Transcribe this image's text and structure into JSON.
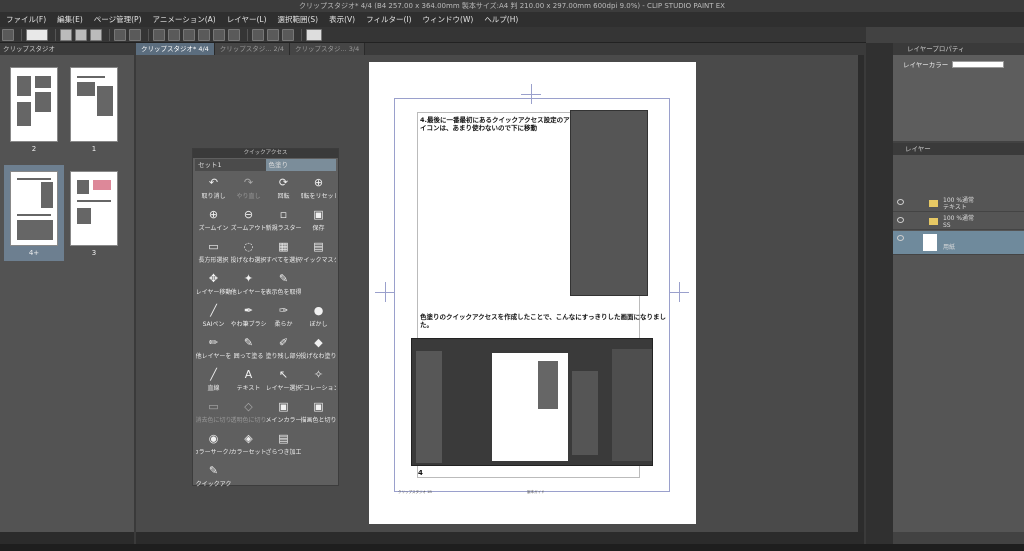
{
  "titlebar": {
    "title": "クリップスタジオ* 4/4 (B4 257.00 x 364.00mm 製本サイズ:A4 判 210.00 x 297.00mm 600dpi 9.0%) - CLIP STUDIO PAINT EX"
  },
  "menu": [
    "ファイル(F)",
    "編集(E)",
    "ページ管理(P)",
    "アニメーション(A)",
    "レイヤー(L)",
    "選択範囲(S)",
    "表示(V)",
    "フィルター(I)",
    "ウィンドウ(W)",
    "ヘルプ(H)"
  ],
  "left_panel": {
    "tab": "クリップスタジオ",
    "pages": [
      {
        "label": "2",
        "selected": false
      },
      {
        "label": "1",
        "selected": false
      },
      {
        "label": "4+",
        "selected": true
      },
      {
        "label": "3",
        "selected": false
      }
    ]
  },
  "canvas_tabs": [
    {
      "label": "クリップスタジオ* 4/4",
      "active": true
    },
    {
      "label": "クリップスタジ... 2/4",
      "active": false
    },
    {
      "label": "クリップスタジ... 3/4",
      "active": false
    }
  ],
  "quick_access": {
    "title": "クイックアクセス",
    "sets": [
      "セット1",
      "色塗り"
    ],
    "active_set": 1,
    "items": [
      {
        "label": "取り消し",
        "icon": "↶",
        "dim": false
      },
      {
        "label": "やり直し",
        "icon": "↷",
        "dim": true
      },
      {
        "label": "回転",
        "icon": "⟳",
        "dim": false
      },
      {
        "label": "回転をリセット",
        "icon": "⊕",
        "dim": false
      },
      {
        "label": "ズームイン",
        "icon": "⊕",
        "dim": false
      },
      {
        "label": "ズームアウト",
        "icon": "⊖",
        "dim": false
      },
      {
        "label": "新規ラスター",
        "icon": "▫",
        "dim": false
      },
      {
        "label": "保存",
        "icon": "▣",
        "dim": false
      },
      {
        "label": "長方形選択",
        "icon": "▭",
        "dim": false
      },
      {
        "label": "投げなわ選択",
        "icon": "◌",
        "dim": false
      },
      {
        "label": "すべてを選択",
        "icon": "▦",
        "dim": false
      },
      {
        "label": "クイックマスク",
        "icon": "▤",
        "dim": false
      },
      {
        "label": "レイヤー移動",
        "icon": "✥",
        "dim": false
      },
      {
        "label": "他レイヤーを",
        "icon": "✦",
        "dim": false
      },
      {
        "label": "表示色を取得",
        "icon": "✎",
        "dim": false
      },
      {
        "label": "",
        "icon": "",
        "dim": false
      },
      {
        "label": "SAIペン",
        "icon": "╱",
        "dim": false
      },
      {
        "label": "やわ筆ブラシ",
        "icon": "✒",
        "dim": false
      },
      {
        "label": "柔らか",
        "icon": "✑",
        "dim": false
      },
      {
        "label": "ぼかし",
        "icon": "●",
        "dim": false
      },
      {
        "label": "他レイヤーを",
        "icon": "✏",
        "dim": false
      },
      {
        "label": "囲って塗る",
        "icon": "✎",
        "dim": false
      },
      {
        "label": "塗り残し部分",
        "icon": "✐",
        "dim": false
      },
      {
        "label": "投げなわ塗り",
        "icon": "◆",
        "dim": false
      },
      {
        "label": "直線",
        "icon": "╱",
        "dim": false
      },
      {
        "label": "テキスト",
        "icon": "A",
        "dim": false
      },
      {
        "label": "レイヤー選択",
        "icon": "↖",
        "dim": false
      },
      {
        "label": "デコレーション",
        "icon": "✧",
        "dim": false
      },
      {
        "label": "消去色に切り",
        "icon": "▭",
        "dim": true
      },
      {
        "label": "透明色に切り",
        "icon": "◇",
        "dim": true
      },
      {
        "label": "メインカラー",
        "icon": "▣",
        "dim": false
      },
      {
        "label": "描画色と切り",
        "icon": "▣",
        "dim": false
      },
      {
        "label": "カラーサークル",
        "icon": "◉",
        "dim": false
      },
      {
        "label": "カラーセット",
        "icon": "◈",
        "dim": false
      },
      {
        "label": "ざらつき加工",
        "icon": "▤",
        "dim": false
      },
      {
        "label": "",
        "icon": "",
        "dim": false
      },
      {
        "label": "クイックアク",
        "icon": "✎",
        "dim": false
      }
    ]
  },
  "document": {
    "heading1": "4.最後に一番最初にあるクイックアクセス設定のアイコンは、あまり使わないので下に移動",
    "heading2": "色塗りのクイックアクセスを作成したことで、こんなにすっきりした画面になりました。",
    "page_number": "4",
    "footer_left": "クリップスタジオ 1B",
    "footer_right": "製本ガイド"
  },
  "right_panel": {
    "properties_tab": "レイヤープロパティ",
    "layer_color_label": "レイヤーカラー",
    "layers_tab": "レイヤー",
    "layers": [
      {
        "line1": "100 %通常",
        "line2": "テキスト",
        "type": "folder",
        "selected": false
      },
      {
        "line1": "100 %通常",
        "line2": "SS",
        "type": "folder",
        "selected": false
      },
      {
        "line1": "",
        "line2": "用紙",
        "type": "paper",
        "selected": true
      }
    ]
  },
  "colors": {
    "accent": "#6f8a9c",
    "panel": "#5f5f5f",
    "background": "#4a4a4a"
  }
}
